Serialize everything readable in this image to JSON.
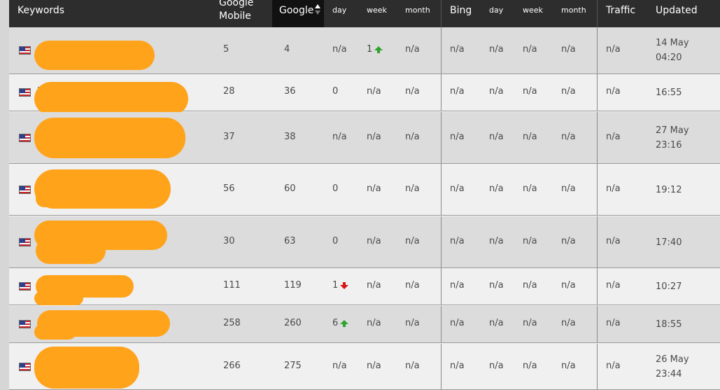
{
  "colors": {
    "header_bg": "#2d2d2d",
    "sorted_header_bg": "#111111",
    "row_odd": "#dcdcdc",
    "row_even": "#f0f0f0",
    "redaction": "#ffa31a",
    "trend_up": "#2ea32e",
    "trend_down": "#d8141a"
  },
  "header": {
    "keywords": "Keywords",
    "google_mobile_1": "Google",
    "google_mobile_2": "Mobile",
    "google": "Google",
    "g_day": "day",
    "g_week": "week",
    "g_month": "month",
    "bing": "Bing",
    "b_day": "day",
    "b_week": "week",
    "b_month": "month",
    "traffic": "Traffic",
    "updated": "Updated"
  },
  "rows": [
    {
      "keyword": "",
      "google_mobile": "5",
      "google": "4",
      "g_day": "n/a",
      "g_week": "1",
      "g_week_trend": "up",
      "g_month": "n/a",
      "bing": "n/a",
      "b_day": "n/a",
      "b_week": "n/a",
      "b_month": "n/a",
      "traffic": "n/a",
      "updated_1": "14 May",
      "updated_2": "04:20"
    },
    {
      "keyword": "I",
      "google_mobile": "28",
      "google": "36",
      "g_day": "0",
      "g_week": "n/a",
      "g_month": "n/a",
      "bing": "n/a",
      "b_day": "n/a",
      "b_week": "n/a",
      "b_month": "n/a",
      "traffic": "n/a",
      "updated_1": "16:55",
      "updated_2": ""
    },
    {
      "keyword": "I",
      "google_mobile": "37",
      "google": "38",
      "g_day": "n/a",
      "g_week": "n/a",
      "g_month": "n/a",
      "bing": "n/a",
      "b_day": "n/a",
      "b_week": "n/a",
      "b_month": "n/a",
      "traffic": "n/a",
      "updated_1": "27 May",
      "updated_2": "23:16"
    },
    {
      "keyword": "I",
      "google_mobile": "56",
      "google": "60",
      "g_day": "0",
      "g_week": "n/a",
      "g_month": "n/a",
      "bing": "n/a",
      "b_day": "n/a",
      "b_week": "n/a",
      "b_month": "n/a",
      "traffic": "n/a",
      "updated_1": "19:12",
      "updated_2": ""
    },
    {
      "keyword": "I",
      "google_mobile": "30",
      "google": "63",
      "g_day": "0",
      "g_week": "n/a",
      "g_month": "n/a",
      "bing": "n/a",
      "b_day": "n/a",
      "b_week": "n/a",
      "b_month": "n/a",
      "traffic": "n/a",
      "updated_1": "17:40",
      "updated_2": ""
    },
    {
      "keyword": "h",
      "google_mobile": "111",
      "google": "119",
      "g_day": "1",
      "g_day_trend": "down",
      "g_week": "n/a",
      "g_month": "n/a",
      "bing": "n/a",
      "b_day": "n/a",
      "b_week": "n/a",
      "b_month": "n/a",
      "traffic": "n/a",
      "updated_1": "10:27",
      "updated_2": ""
    },
    {
      "keyword": "v",
      "google_mobile": "258",
      "google": "260",
      "g_day": "6",
      "g_day_trend": "up",
      "g_week": "n/a",
      "g_month": "n/a",
      "bing": "n/a",
      "b_day": "n/a",
      "b_week": "n/a",
      "b_month": "n/a",
      "traffic": "n/a",
      "updated_1": "18:55",
      "updated_2": ""
    },
    {
      "keyword": "",
      "google_mobile": "266",
      "google": "275",
      "g_day": "n/a",
      "g_week": "n/a",
      "g_month": "n/a",
      "bing": "n/a",
      "b_day": "n/a",
      "b_week": "n/a",
      "b_month": "n/a",
      "traffic": "n/a",
      "updated_1": "26 May",
      "updated_2": "23:44"
    }
  ]
}
